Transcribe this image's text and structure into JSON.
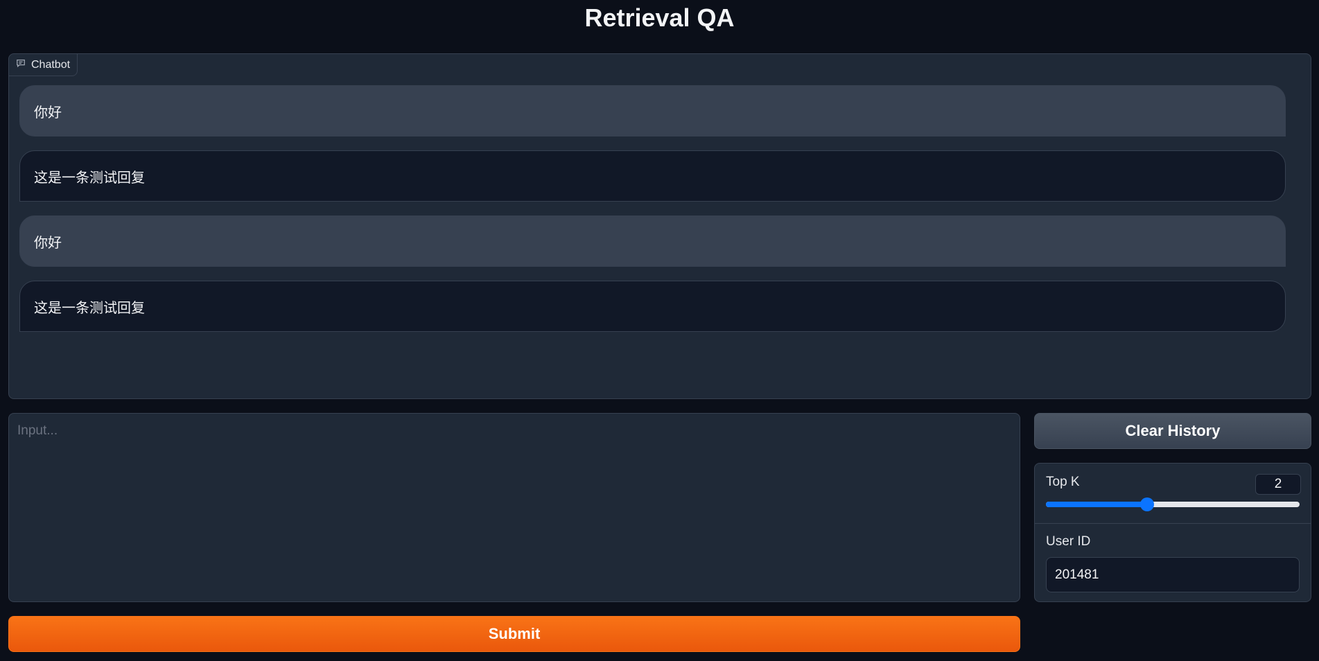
{
  "title": "Retrieval QA",
  "chatbot": {
    "label": "Chatbot",
    "messages": [
      {
        "role": "user",
        "text": "你好"
      },
      {
        "role": "bot",
        "text": "这是一条测试回复"
      },
      {
        "role": "user",
        "text": "你好"
      },
      {
        "role": "bot",
        "text": "这是一条测试回复"
      }
    ]
  },
  "input": {
    "placeholder": "Input...",
    "value": ""
  },
  "buttons": {
    "submit": "Submit",
    "clear_history": "Clear History"
  },
  "settings": {
    "top_k": {
      "label": "Top K",
      "value": "2",
      "slider_fraction": 0.4
    },
    "user_id": {
      "label": "User ID",
      "value": "201481"
    }
  },
  "colors": {
    "accent": "#f97316",
    "slider": "#0b74ff",
    "background": "#0b0f19"
  }
}
